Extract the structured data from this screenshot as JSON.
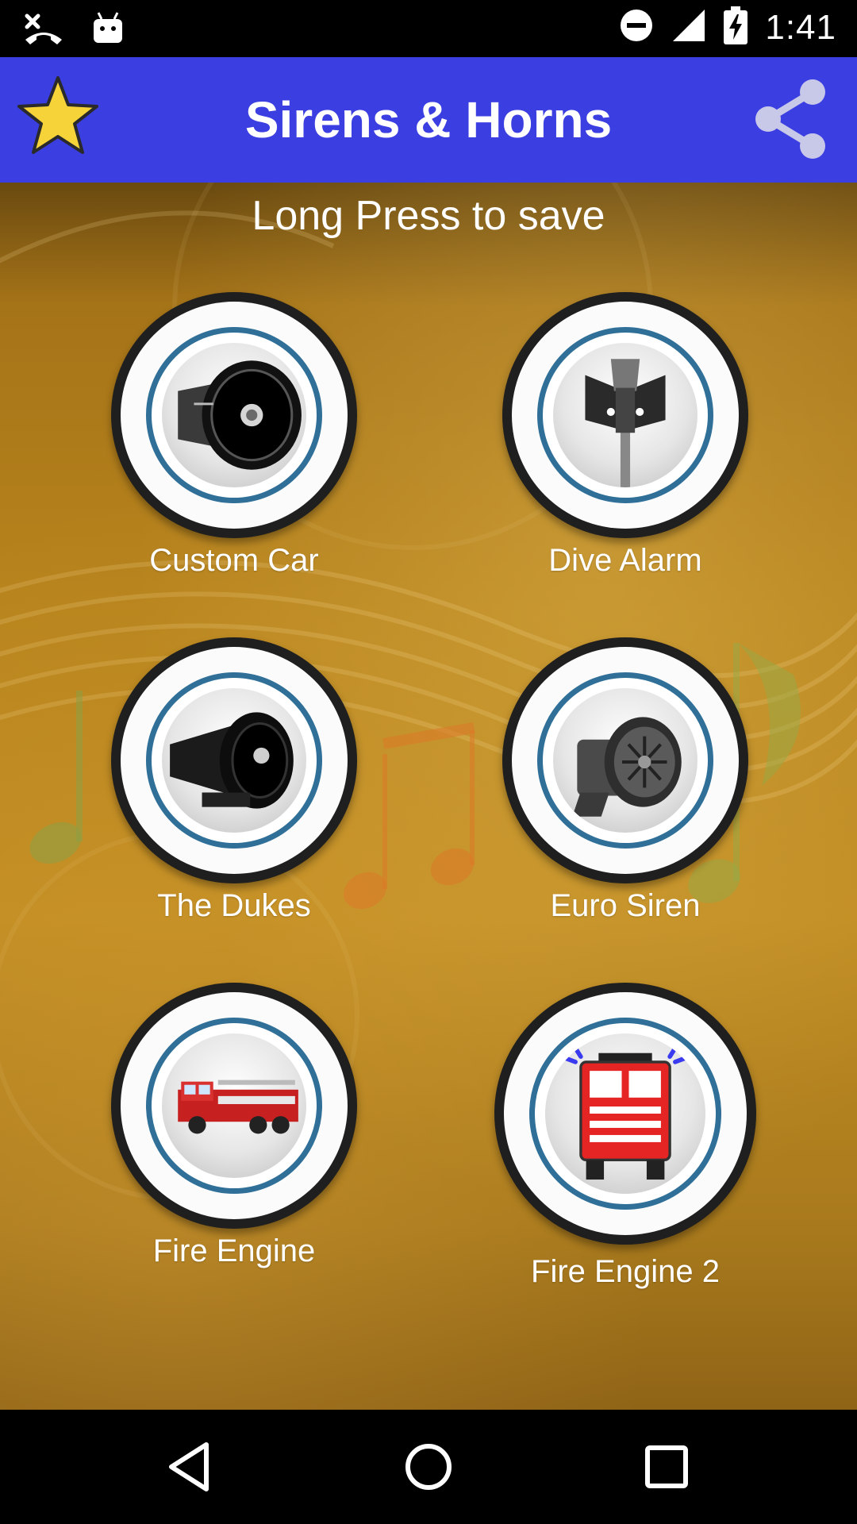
{
  "status_bar": {
    "time": "1:41",
    "icons": [
      "missed-call-icon",
      "android-icon",
      "do-not-disturb-icon",
      "signal-icon",
      "battery-charging-icon"
    ]
  },
  "app_bar": {
    "title": "Sirens & Horns",
    "left_icon": "star-icon",
    "right_icon": "share-icon",
    "background": "#3b3ee0",
    "star_color": "#f7d33a"
  },
  "content": {
    "hint": "Long Press to save",
    "items": [
      {
        "label": "Custom Car",
        "icon": "horn-speaker-icon"
      },
      {
        "label": "Dive Alarm",
        "icon": "pole-siren-icon"
      },
      {
        "label": "The Dukes",
        "icon": "car-horn-icon"
      },
      {
        "label": "Euro Siren",
        "icon": "motor-siren-icon"
      },
      {
        "label": "Fire Engine",
        "icon": "fire-truck-side-icon"
      },
      {
        "label": "Fire Engine 2",
        "icon": "fire-truck-front-icon"
      }
    ]
  },
  "nav_bar": {
    "buttons": [
      "back-icon",
      "home-icon",
      "recents-icon"
    ]
  }
}
